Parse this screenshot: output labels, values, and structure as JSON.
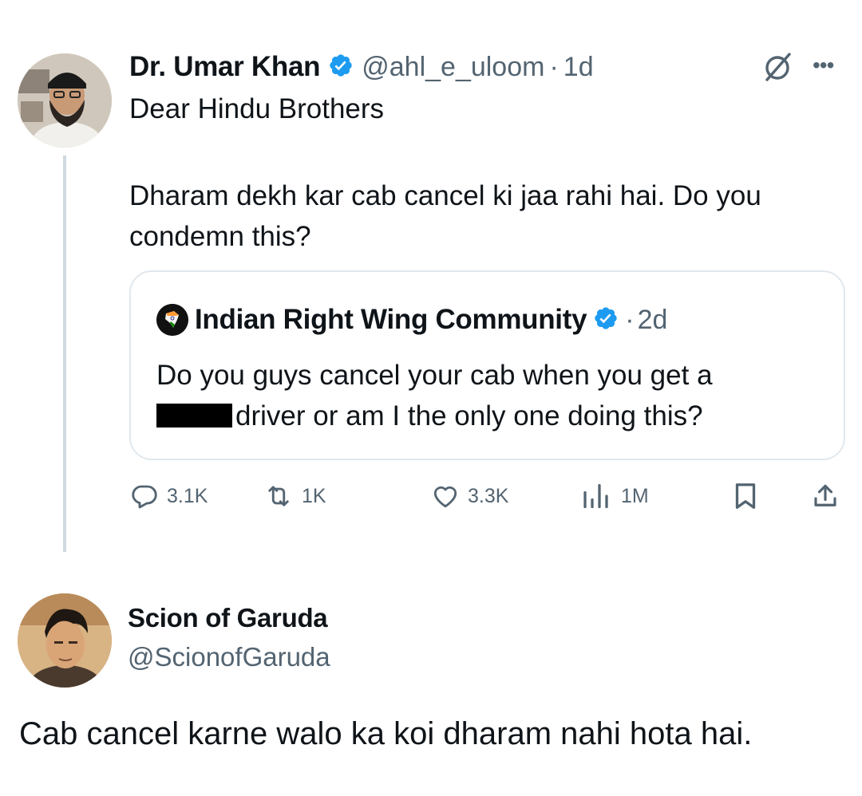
{
  "tweet": {
    "author_name": "Dr. Umar Khan",
    "author_handle": "@ahl_e_uloom",
    "separator": "·",
    "time": "1d",
    "text_line1": "Dear Hindu Brothers",
    "text_body": "Dharam dekh kar cab cancel ki jaa rahi hai. Do you condemn this?",
    "verified_color": "#1d9bf0"
  },
  "quote": {
    "author_name": "Indian Right Wing Community",
    "separator": "·",
    "time": "2d",
    "text_line1": "Do you guys cancel your cab when you get a",
    "text_line2": "driver or am I the only one doing this?"
  },
  "actions": {
    "replies": "3.1K",
    "reposts": "1K",
    "likes": "3.3K",
    "views": "1M"
  },
  "reply": {
    "author_name": "Scion of Garuda",
    "author_handle": "@ScionofGaruda",
    "text": "Cab cancel karne walo ka koi dharam nahi hota hai."
  },
  "colors": {
    "text": "#0f1419",
    "secondary": "#536471",
    "border": "#e1e8ed",
    "thread_line": "#cfd9de"
  }
}
